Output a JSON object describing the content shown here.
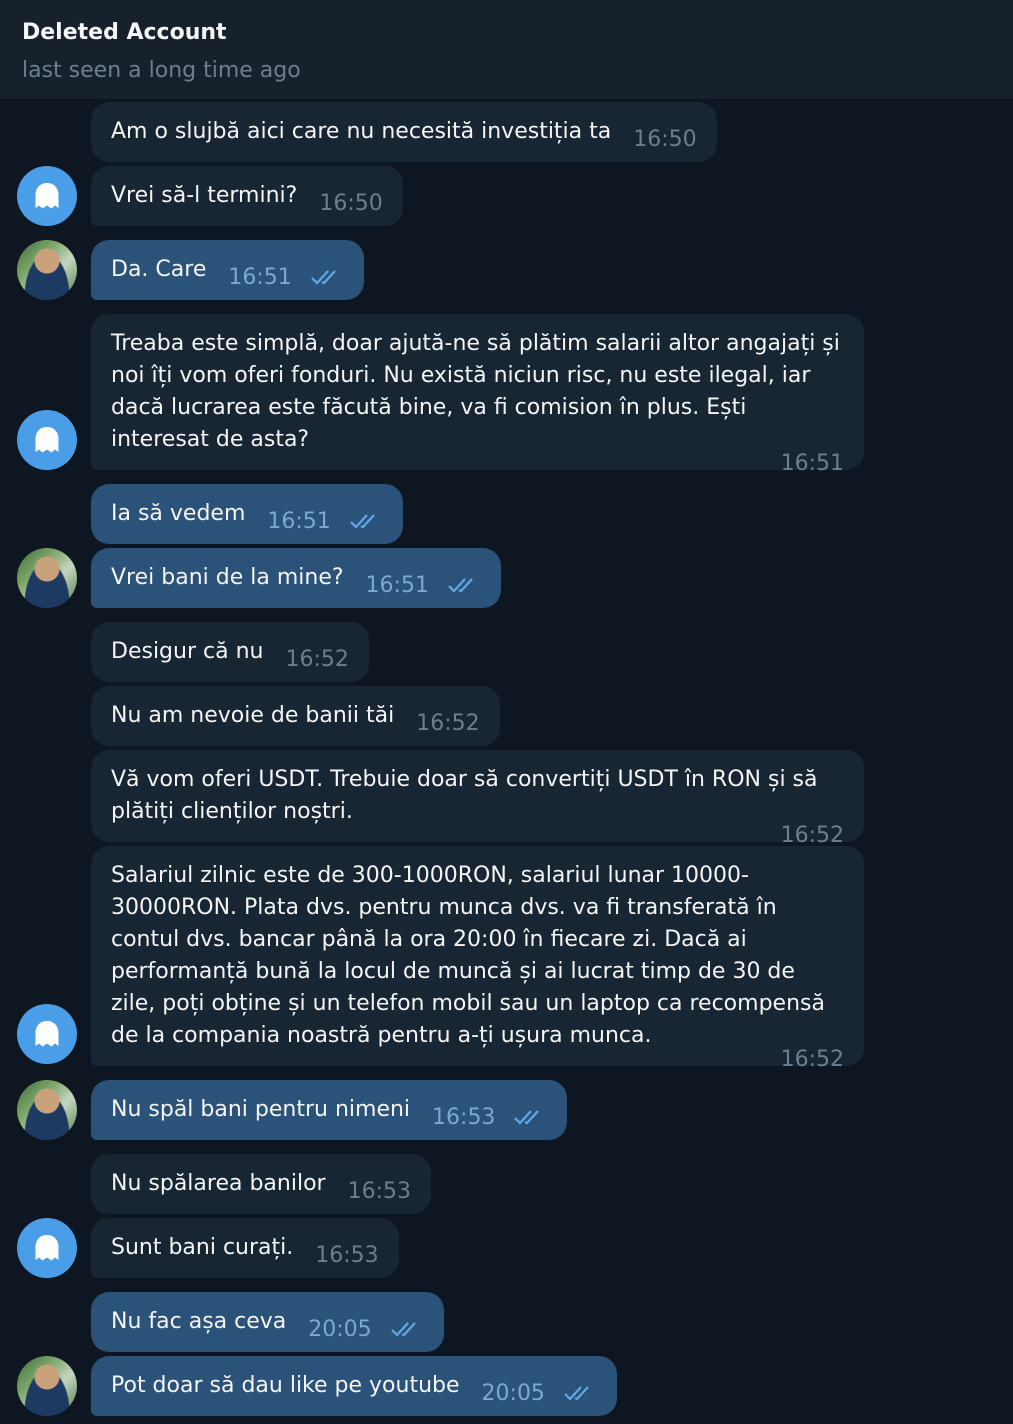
{
  "header": {
    "title": "Deleted Account",
    "status": "last seen a long time ago"
  },
  "icons": {
    "ghost_avatar": "ghost-icon",
    "user_avatar": "user-photo-avatar",
    "read_ticks": "double-check-icon"
  },
  "colors": {
    "background": "#0e1621",
    "header": "#17212b",
    "incoming_bubble": "#182533",
    "outgoing_bubble": "#2b5278",
    "ghost_avatar": "#4a9ee8",
    "ticks": "#62a8e8"
  },
  "messages": [
    {
      "from": "contact",
      "text": "Am o slujbă aici care nu necesită investiția ta",
      "time": "16:50"
    },
    {
      "from": "contact",
      "text": "Vrei să-l termini?",
      "time": "16:50"
    },
    {
      "from": "me",
      "text": "Da. Care",
      "time": "16:51",
      "read": true
    },
    {
      "from": "contact",
      "text": "Treaba este simplă, doar ajută-ne să plătim salarii altor angajați și noi îți vom oferi fonduri. Nu există niciun risc, nu este ilegal, iar dacă lucrarea este făcută bine, va fi comision în plus. Ești interesat de asta?",
      "time": "16:51"
    },
    {
      "from": "me",
      "text": "Ia să vedem",
      "time": "16:51",
      "read": true
    },
    {
      "from": "me",
      "text": "Vrei bani de la mine?",
      "time": "16:51",
      "read": true
    },
    {
      "from": "contact",
      "text": "Desigur că nu",
      "time": "16:52"
    },
    {
      "from": "contact",
      "text": "Nu am nevoie de banii tăi",
      "time": "16:52"
    },
    {
      "from": "contact",
      "text": "Vă vom oferi USDT. Trebuie doar să convertiți USDT în RON și să plătiți clienților noștri.",
      "time": "16:52"
    },
    {
      "from": "contact",
      "text": "Salariul zilnic este de 300-1000RON, salariul lunar 10000-30000RON. Plata dvs. pentru munca dvs. va fi transferată în contul dvs. bancar până la ora 20:00 în fiecare zi. Dacă ai performanță bună la locul de muncă și ai lucrat timp de 30 de zile, poți obține și un telefon mobil sau un laptop ca recompensă de la compania noastră pentru a-ți ușura munca.",
      "time": "16:52"
    },
    {
      "from": "me",
      "text": "Nu spăl bani pentru nimeni",
      "time": "16:53",
      "read": true
    },
    {
      "from": "contact",
      "text": "Nu spălarea banilor",
      "time": "16:53"
    },
    {
      "from": "contact",
      "text": "Sunt bani curați.",
      "time": "16:53"
    },
    {
      "from": "me",
      "text": "Nu fac așa ceva",
      "time": "20:05",
      "read": true
    },
    {
      "from": "me",
      "text": "Pot doar să dau like pe youtube",
      "time": "20:05",
      "read": true
    }
  ]
}
